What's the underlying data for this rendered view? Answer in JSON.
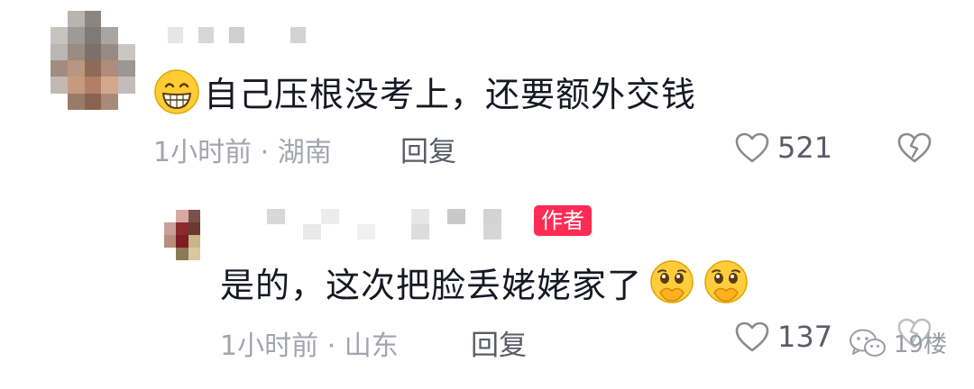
{
  "comments": [
    {
      "text": "自己压根没考上，还要额外交钱",
      "leading_emoji": "grinning-face",
      "time_location": "1小时前 · 湖南",
      "reply_label": "回复",
      "likes": "521",
      "reply": {
        "badge": "作者",
        "text": "是的，这次把脸丢姥姥家了",
        "trailing_emojis": [
          "face-holding-back-tears-covering-mouth",
          "face-holding-back-tears-covering-mouth"
        ],
        "time_location": "1小时前 · 山东",
        "reply_label": "回复",
        "likes": "137"
      }
    }
  ],
  "watermark": {
    "text": "19楼"
  },
  "colors": {
    "badge": "#fe2c55",
    "meta": "#a3a5ad",
    "text": "#161823"
  }
}
